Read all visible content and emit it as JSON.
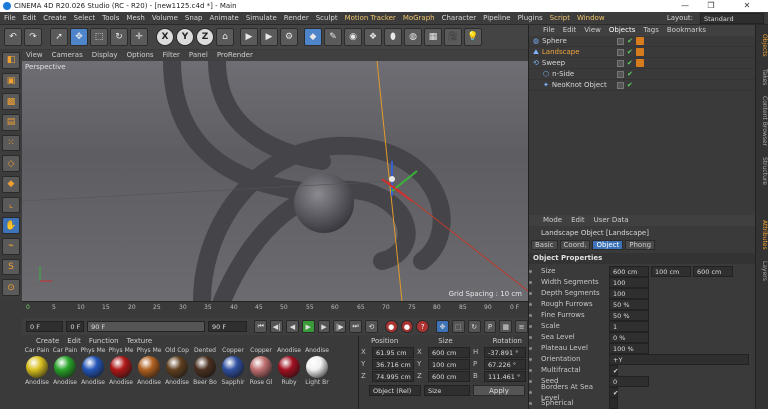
{
  "window": {
    "title": "CINEMA 4D R20.026 Studio (RC - R20) - [new1125.c4d *] - Main"
  },
  "menubar": {
    "items": [
      "File",
      "Edit",
      "Create",
      "Select",
      "Tools",
      "Mesh",
      "Volume",
      "Snap",
      "Animate",
      "Simulate",
      "Render",
      "Sculpt",
      "Motion Tracker",
      "MoGraph",
      "Character",
      "Pipeline",
      "Plugins",
      "Script",
      "Window"
    ],
    "layout_label": "Layout:",
    "layout_value": "Standard"
  },
  "viewport": {
    "menu": [
      "View",
      "Cameras",
      "Display",
      "Options",
      "Filter",
      "Panel",
      "ProRender"
    ],
    "label": "Perspective",
    "grid_spacing": "Grid Spacing : 10 cm"
  },
  "timeline": {
    "ticks": [
      "0",
      "5",
      "10",
      "15",
      "20",
      "25",
      "30",
      "35",
      "40",
      "45",
      "50",
      "55",
      "60",
      "65",
      "70",
      "75",
      "80",
      "85",
      "90"
    ],
    "end_label": "0 F"
  },
  "playback": {
    "start": "0 F",
    "current": "0 F",
    "end_a": "90 F",
    "end_b": "90 F"
  },
  "materials": {
    "menu": [
      "Create",
      "Edit",
      "Function",
      "Texture"
    ],
    "items": [
      {
        "top": "Car Pain",
        "bottom": "Anodise",
        "color": "#d8c020"
      },
      {
        "top": "Car Pain",
        "bottom": "Anodise",
        "color": "#2aa42a"
      },
      {
        "top": "Phys Me",
        "bottom": "Anodise",
        "color": "#2456b8"
      },
      {
        "top": "Phys Me",
        "bottom": "Anodise",
        "color": "#b01818"
      },
      {
        "top": "Phys Me",
        "bottom": "Anodise",
        "color": "#b06020"
      },
      {
        "top": "Old Cop",
        "bottom": "Anodise",
        "color": "#604020"
      },
      {
        "top": "Dented",
        "bottom": "Beer Bo",
        "color": "#4a3020"
      },
      {
        "top": "Copper",
        "bottom": "Sapphir",
        "color": "#3050a0"
      },
      {
        "top": "Copper",
        "bottom": "Rose Gl",
        "color": "#c07070"
      },
      {
        "top": "Anodise",
        "bottom": "Ruby",
        "color": "#a01020"
      },
      {
        "top": "Anodise",
        "bottom": "Light Br",
        "color": "#f0f0f0"
      }
    ]
  },
  "coords": {
    "headers": [
      "Position",
      "Size",
      "Rotation"
    ],
    "rows": [
      {
        "axis": "X",
        "pos": "61.95 cm",
        "size": "600 cm",
        "rl": "H",
        "rot": "-37.891 °"
      },
      {
        "axis": "Y",
        "pos": "36.716 cm",
        "size": "100 cm",
        "rl": "P",
        "rot": "67.226 °"
      },
      {
        "axis": "Z",
        "pos": "74.995 cm",
        "size": "600 cm",
        "rl": "B",
        "rot": "111.461 °"
      }
    ],
    "mode": "Object (Rel)",
    "size_mode": "Size",
    "apply": "Apply"
  },
  "objects": {
    "tabs": [
      "File",
      "Edit",
      "View",
      "Objects",
      "Tags",
      "Bookmarks"
    ],
    "items": [
      {
        "name": "Sphere",
        "indent": 0
      },
      {
        "name": "Landscape",
        "indent": 0,
        "selected": true
      },
      {
        "name": "Sweep",
        "indent": 0
      },
      {
        "name": "n-Side",
        "indent": 1
      },
      {
        "name": "NeoKnot Object",
        "indent": 1
      }
    ]
  },
  "attributes": {
    "menu": [
      "Mode",
      "Edit",
      "User Data"
    ],
    "title": "Landscape Object [Landscape]",
    "tabs": [
      "Basic",
      "Coord.",
      "Object",
      "Phong"
    ],
    "section": "Object Properties",
    "props": [
      {
        "label": "Size",
        "values": [
          "600 cm",
          "100 cm",
          "600 cm"
        ]
      },
      {
        "label": "Width Segments",
        "values": [
          "100"
        ]
      },
      {
        "label": "Depth Segments",
        "values": [
          "100"
        ]
      },
      {
        "label": "Rough Furrows",
        "values": [
          "50 %"
        ]
      },
      {
        "label": "Fine Furrows",
        "values": [
          "50 %"
        ]
      },
      {
        "label": "Scale",
        "values": [
          "1"
        ]
      },
      {
        "label": "Sea Level",
        "values": [
          "0 %"
        ]
      },
      {
        "label": "Plateau Level",
        "values": [
          "100 %"
        ]
      },
      {
        "label": "Orientation",
        "values": [
          "+Y"
        ]
      },
      {
        "label": "Multifractal",
        "values": [
          "✔"
        ]
      },
      {
        "label": "Seed",
        "values": [
          "0"
        ]
      },
      {
        "label": "Borders At Sea Level",
        "values": [
          "✔"
        ]
      },
      {
        "label": "Spherical",
        "values": [
          ""
        ]
      }
    ]
  },
  "side_tabs": [
    "Objects",
    "Takes",
    "Content Browser",
    "Structure",
    "Attributes",
    "Layers"
  ]
}
